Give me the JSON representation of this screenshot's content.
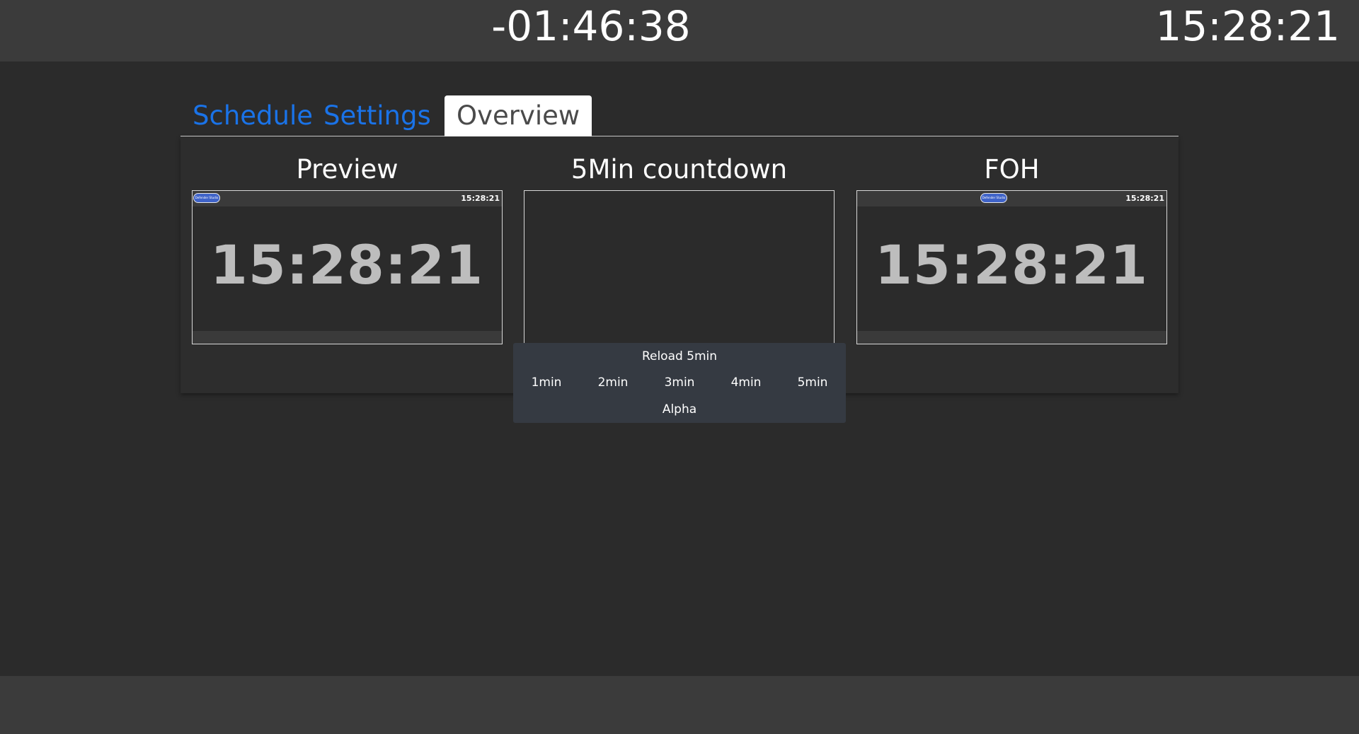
{
  "header": {
    "countdown": "-01:46:38",
    "clock": "15:28:21"
  },
  "tabs": [
    {
      "label": "Schedule",
      "active": false
    },
    {
      "label": "Settings",
      "active": false
    },
    {
      "label": "Overview",
      "active": true
    }
  ],
  "views": {
    "preview": {
      "title": "Preview",
      "mini_time": "15:28:21",
      "big_time": "15:28:21",
      "logo_text": "Defender Studio"
    },
    "countdown5": {
      "title": "5Min countdown"
    },
    "foh": {
      "title": "FOH",
      "mini_time": "15:28:21",
      "big_time": "15:28:21",
      "logo_text": "Defender Studio"
    }
  },
  "controls": {
    "reload_label": "Reload 5min",
    "presets": [
      "1min",
      "2min",
      "3min",
      "4min",
      "5min"
    ],
    "alpha_label": "Alpha"
  },
  "colors": {
    "background": "#2b2b2b",
    "bar": "#3b3b3b",
    "tab_link": "#1a73e8",
    "controls_bg": "#353a42"
  }
}
